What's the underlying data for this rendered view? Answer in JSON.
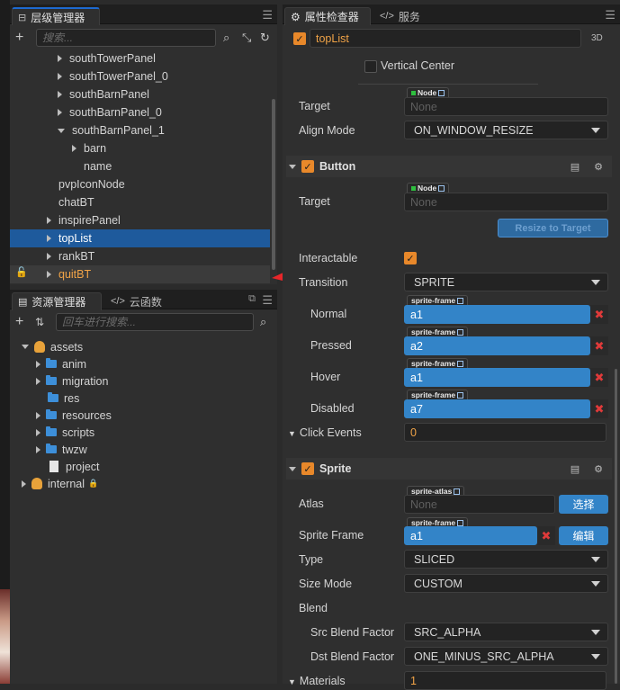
{
  "hierarchy": {
    "tab": "层级管理器",
    "search_placeholder": "搜索...",
    "nodes": [
      {
        "label": "southTowerPanel",
        "arrow": "right",
        "indent": 1
      },
      {
        "label": "southTowerPanel_0",
        "arrow": "right",
        "indent": 1
      },
      {
        "label": "southBarnPanel",
        "arrow": "right",
        "indent": 1
      },
      {
        "label": "southBarnPanel_0",
        "arrow": "right",
        "indent": 1
      },
      {
        "label": "southBarnPanel_1",
        "arrow": "down",
        "indent": 1
      },
      {
        "label": "barn",
        "arrow": "right",
        "indent": 2
      },
      {
        "label": "name",
        "arrow": "none",
        "indent": 2
      },
      {
        "label": "pvpIconNode",
        "arrow": "none",
        "indent": 0
      },
      {
        "label": "chatBT",
        "arrow": "none",
        "indent": 0
      },
      {
        "label": "inspirePanel",
        "arrow": "right",
        "indent": 0
      },
      {
        "label": "topList",
        "arrow": "right",
        "indent": 0,
        "selected": true
      },
      {
        "label": "rankBT",
        "arrow": "right",
        "indent": 0
      },
      {
        "label": "quitBT",
        "arrow": "right",
        "indent": 0,
        "orange": true
      }
    ]
  },
  "assets": {
    "tab": "资源管理器",
    "tab2": "云函数",
    "search_placeholder": "回车进行搜索...",
    "items": [
      {
        "label": "assets",
        "type": "db",
        "arrow": "down",
        "level": 0
      },
      {
        "label": "anim",
        "type": "folder",
        "arrow": "right",
        "level": 1
      },
      {
        "label": "migration",
        "type": "folder",
        "arrow": "right",
        "level": 1
      },
      {
        "label": "res",
        "type": "folder",
        "arrow": "none",
        "level": 1
      },
      {
        "label": "resources",
        "type": "folder",
        "arrow": "right",
        "level": 1
      },
      {
        "label": "scripts",
        "type": "folder",
        "arrow": "right",
        "level": 1
      },
      {
        "label": "twzw",
        "type": "folder",
        "arrow": "right",
        "level": 1
      },
      {
        "label": "project",
        "type": "file",
        "arrow": "none",
        "level": 1
      },
      {
        "label": "internal",
        "type": "db",
        "arrow": "right",
        "level": 0,
        "lock": true
      }
    ]
  },
  "inspector": {
    "tab": "属性检查器",
    "tab2": "服务",
    "node_name": "topList",
    "mode_3d": "3D",
    "vertical_center": "Vertical Center",
    "widget": {
      "target_label": "Target",
      "badge": "Node",
      "none": "None",
      "align_label": "Align Mode",
      "align_value": "ON_WINDOW_RESIZE"
    },
    "button": {
      "title": "Button",
      "target_label": "Target",
      "badge": "Node",
      "none": "None",
      "resize": "Resize to Target",
      "interactable": "Interactable",
      "transition_label": "Transition",
      "transition_value": "SPRITE",
      "states": [
        {
          "label": "Normal",
          "value": "a1"
        },
        {
          "label": "Pressed",
          "value": "a2"
        },
        {
          "label": "Hover",
          "value": "a1"
        },
        {
          "label": "Disabled",
          "value": "a7"
        }
      ],
      "frame_badge": "sprite-frame",
      "click_label": "Click Events",
      "click_value": "0"
    },
    "sprite": {
      "title": "Sprite",
      "atlas_label": "Atlas",
      "atlas_badge": "sprite-atlas",
      "atlas_value": "None",
      "atlas_btn": "选择",
      "frame_label": "Sprite Frame",
      "frame_badge": "sprite-frame",
      "frame_value": "a1",
      "frame_btn": "编辑",
      "type_label": "Type",
      "type_value": "SLICED",
      "size_label": "Size Mode",
      "size_value": "CUSTOM",
      "blend_label": "Blend",
      "src_label": "Src Blend Factor",
      "src_value": "SRC_ALPHA",
      "dst_label": "Dst Blend Factor",
      "dst_value": "ONE_MINUS_SRC_ALPHA",
      "materials_label": "Materials",
      "materials_value": "1"
    }
  },
  "colors": {
    "accent": "#e8882a",
    "selection": "#1e5a9c",
    "field_blue": "#3384c8",
    "arrow": "#e8262a"
  }
}
